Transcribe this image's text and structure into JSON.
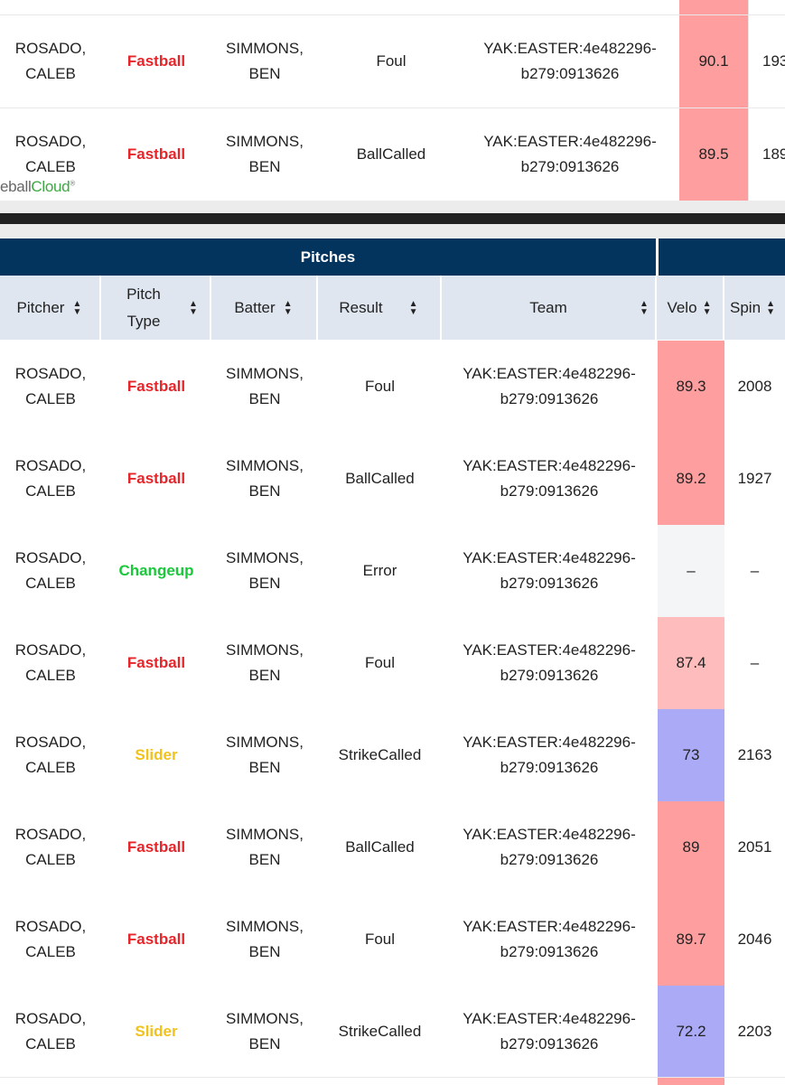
{
  "colors": {
    "fastball": "#e5252a",
    "changeup": "#19c93a",
    "slider": "#f1c21b",
    "header_navy": "#03345e",
    "header_gray": "#dfe6ef",
    "velo_high": "#ff9e9e",
    "velo_mid": "#ffbcbc",
    "velo_low": "#aaaaf6",
    "velo_none": "#f4f5f7"
  },
  "top_table": {
    "rows": [
      {
        "pitcher": "ROSADO, CALEB",
        "pitch_type": "Fastball",
        "batter": "SIMMONS, BEN",
        "result": "Foul",
        "team": "YAK:EASTER:4e482296-b279:0913626",
        "velo": "90.1",
        "spin": "193"
      },
      {
        "pitcher": "ROSADO, CALEB",
        "pitch_type": "Fastball",
        "batter": "SIMMONS, BEN",
        "result": "BallCalled",
        "team": "YAK:EASTER:4e482296-b279:0913626",
        "velo": "89.5",
        "spin": "189"
      }
    ]
  },
  "logo": {
    "part_a": "eball",
    "part_b": "Cloud",
    "mark": "®"
  },
  "table": {
    "group_header": "Pitches",
    "headers": {
      "pitcher": "Pitcher",
      "pitch_type": "Pitch Type",
      "batter": "Batter",
      "result": "Result",
      "team": "Team",
      "velo": "Velo",
      "spin": "Spin"
    },
    "sort_icon": {
      "up": "▲",
      "down": "▼"
    },
    "rows": [
      {
        "pitcher": "ROSADO, CALEB",
        "pitch_type": "Fastball",
        "batter": "SIMMONS, BEN",
        "result": "Foul",
        "team": "YAK:EASTER:4e482296-b279:0913626",
        "velo": "89.3",
        "spin": "2008",
        "velo_level": "high"
      },
      {
        "pitcher": "ROSADO, CALEB",
        "pitch_type": "Fastball",
        "batter": "SIMMONS, BEN",
        "result": "BallCalled",
        "team": "YAK:EASTER:4e482296-b279:0913626",
        "velo": "89.2",
        "spin": "1927",
        "velo_level": "high"
      },
      {
        "pitcher": "ROSADO, CALEB",
        "pitch_type": "Changeup",
        "batter": "SIMMONS, BEN",
        "result": "Error",
        "team": "YAK:EASTER:4e482296-b279:0913626",
        "velo": "–",
        "spin": "–",
        "velo_level": "none"
      },
      {
        "pitcher": "ROSADO, CALEB",
        "pitch_type": "Fastball",
        "batter": "SIMMONS, BEN",
        "result": "Foul",
        "team": "YAK:EASTER:4e482296-b279:0913626",
        "velo": "87.4",
        "spin": "–",
        "velo_level": "mid"
      },
      {
        "pitcher": "ROSADO, CALEB",
        "pitch_type": "Slider",
        "batter": "SIMMONS, BEN",
        "result": "StrikeCalled",
        "team": "YAK:EASTER:4e482296-b279:0913626",
        "velo": "73",
        "spin": "2163",
        "velo_level": "low"
      },
      {
        "pitcher": "ROSADO, CALEB",
        "pitch_type": "Fastball",
        "batter": "SIMMONS, BEN",
        "result": "BallCalled",
        "team": "YAK:EASTER:4e482296-b279:0913626",
        "velo": "89",
        "spin": "2051",
        "velo_level": "high"
      },
      {
        "pitcher": "ROSADO, CALEB",
        "pitch_type": "Fastball",
        "batter": "SIMMONS, BEN",
        "result": "Foul",
        "team": "YAK:EASTER:4e482296-b279:0913626",
        "velo": "89.7",
        "spin": "2046",
        "velo_level": "high"
      },
      {
        "pitcher": "ROSADO, CALEB",
        "pitch_type": "Slider",
        "batter": "SIMMONS, BEN",
        "result": "StrikeCalled",
        "team": "YAK:EASTER:4e482296-b279:0913626",
        "velo": "72.2",
        "spin": "2203",
        "velo_level": "low"
      }
    ]
  }
}
